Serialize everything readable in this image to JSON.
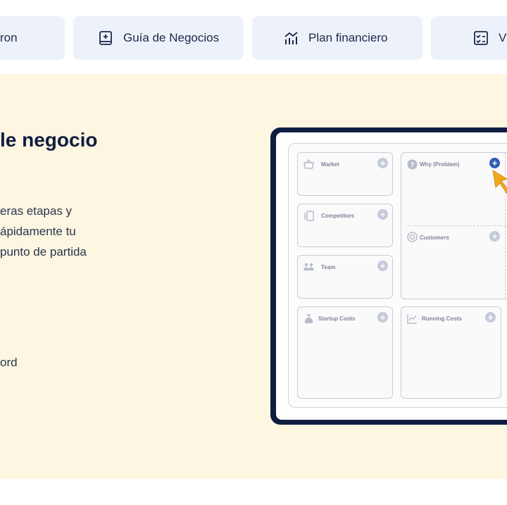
{
  "tabs": [
    {
      "label": "ron",
      "icon": "partial-icon"
    },
    {
      "label": "Guía de Negocios",
      "icon": "book-plus-icon"
    },
    {
      "label": "Plan financiero",
      "icon": "bar-chart-icon"
    },
    {
      "label": "V",
      "icon": "checklist-icon"
    }
  ],
  "hero": {
    "title": "le negocio",
    "lines": [
      "eras etapas y",
      "ápidamente tu",
      "punto de partida"
    ],
    "word": "ord"
  },
  "canvas": {
    "cards": {
      "market": "Market",
      "competitors": "Competitors",
      "team": "Team",
      "startup_costs": "Startup Costs",
      "why": "Why (Problem)",
      "customers": "Customers",
      "running_costs": "Running Costs"
    },
    "plus_symbol": "+",
    "colors": {
      "accent": "#2f5bb8",
      "cursor": "#f0a81c",
      "frame": "#0f1d40",
      "hero_bg": "#fdf6e0"
    }
  }
}
